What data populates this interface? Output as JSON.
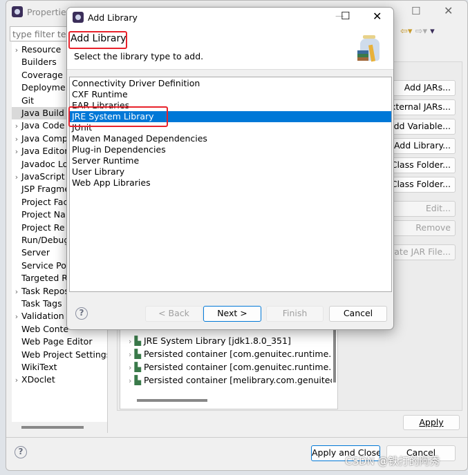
{
  "properties_window": {
    "title": "Properties",
    "filter_placeholder": "type filter text",
    "tree": [
      {
        "label": "Resource",
        "expandable": true
      },
      {
        "label": "Builders"
      },
      {
        "label": "Coverage"
      },
      {
        "label": "Deployme"
      },
      {
        "label": "Git"
      },
      {
        "label": "Java Build P",
        "selected": true
      },
      {
        "label": "Java Code",
        "expandable": true
      },
      {
        "label": "Java Comp",
        "expandable": true
      },
      {
        "label": "Java Editor",
        "expandable": true
      },
      {
        "label": "Javadoc Lo"
      },
      {
        "label": "JavaScript",
        "expandable": true
      },
      {
        "label": "JSP Fragme"
      },
      {
        "label": "Project Fac"
      },
      {
        "label": "Project Na"
      },
      {
        "label": "Project Re"
      },
      {
        "label": "Run/Debug"
      },
      {
        "label": "Server"
      },
      {
        "label": "Service Po"
      },
      {
        "label": "Targeted R"
      },
      {
        "label": "Task Repos",
        "expandable": true
      },
      {
        "label": "Task Tags"
      },
      {
        "label": "Validation",
        "expandable": true
      },
      {
        "label": "Web Conte"
      },
      {
        "label": "Web Page Editor"
      },
      {
        "label": "Web Project Settings"
      },
      {
        "label": "WikiText"
      },
      {
        "label": "XDoclet",
        "expandable": true
      }
    ],
    "side_buttons": [
      {
        "label": "Add JARs...",
        "enabled": true
      },
      {
        "label": "Add External JARs...",
        "enabled": true
      },
      {
        "label": "Add Variable...",
        "enabled": true
      },
      {
        "label": "Add Library...",
        "enabled": true
      },
      {
        "label": "Add Class Folder...",
        "enabled": true
      },
      {
        "label": "Add External Class Folder...",
        "enabled": true
      },
      {
        "label": "Edit...",
        "enabled": false
      },
      {
        "label": "Remove",
        "enabled": false
      },
      {
        "label": "Migrate JAR File...",
        "enabled": false
      }
    ],
    "library_entries": [
      "JRE System Library [jdk1.8.0_351]",
      "Persisted container [com.genuitec.runtime.lib",
      "Persisted container [com.genuitec.runtime.lib",
      "Persisted container [melibrary.com.genuitec."
    ],
    "apply_label": "Apply",
    "apply_close_label": "Apply and Close",
    "cancel_label": "Cancel"
  },
  "dialog": {
    "title": "Add Library",
    "header_title": "Add Library",
    "header_subtitle": "Select the library type to add.",
    "library_types": [
      "Connectivity Driver Definition",
      "CXF Runtime",
      "EAR Libraries",
      "JRE System Library",
      "JUnit",
      "Maven Managed Dependencies",
      "Plug-in Dependencies",
      "Server Runtime",
      "User Library",
      "Web App Libraries"
    ],
    "selected_index": 3,
    "buttons": {
      "back": "< Back",
      "next": "Next >",
      "finish": "Finish",
      "cancel": "Cancel"
    },
    "accent": "#0078d7",
    "highlight_color": "#e8212a"
  },
  "watermark": "CSDN @铁打的阿秀"
}
